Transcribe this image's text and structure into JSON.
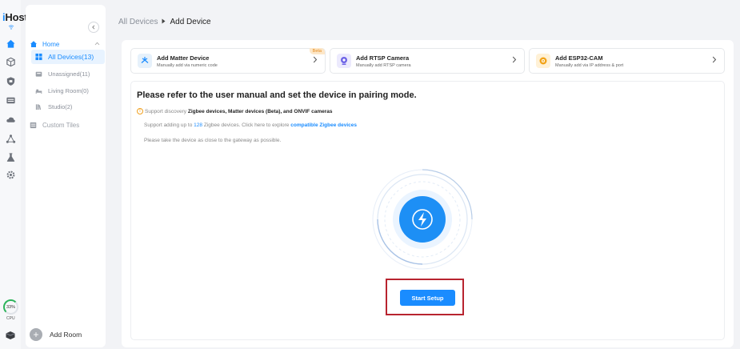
{
  "app": {
    "brand": "iHost",
    "brand_first": "i",
    "brand_rest": "Host"
  },
  "rail": {
    "icons": [
      "home-icon",
      "cube-icon",
      "shield-icon",
      "panel-icon",
      "cloud-icon",
      "network-icon",
      "flask-icon",
      "gear-icon"
    ],
    "cpu_value": "33%",
    "cpu_label": "CPU"
  },
  "sidebar": {
    "home_label": "Home",
    "items": [
      {
        "label": "All Devices(13)",
        "icon": "grid-icon",
        "active": true
      },
      {
        "label": "Unassigned(11)",
        "icon": "tray-icon",
        "active": false
      },
      {
        "label": "Living Room(0)",
        "icon": "bed-icon",
        "active": false
      },
      {
        "label": "Studio(2)",
        "icon": "books-icon",
        "active": false
      }
    ],
    "custom_tiles": "Custom Tiles",
    "add_room": "Add Room"
  },
  "breadcrumb": {
    "root": "All Devices",
    "current": "Add Device"
  },
  "cards": [
    {
      "title": "Add Matter Device",
      "subtitle": "Manually add via numeric code",
      "badge": "Beta",
      "icon": "matter-icon",
      "color": "#e6f1fb"
    },
    {
      "title": "Add RTSP Camera",
      "subtitle": "Manually add RTSP camera",
      "icon": "camera-icon",
      "color": "#eceafd"
    },
    {
      "title": "Add ESP32-CAM",
      "subtitle": "Manually add via IP address & port",
      "icon": "esp-cam-icon",
      "color": "#fff1d6"
    }
  ],
  "pairing": {
    "title": "Please refer to the user manual and set the device in pairing mode.",
    "support_prefix": "Support discovery",
    "support_devices": "Zigbee devices, Matter devices (Beta), and ONVIF cameras",
    "zigbee_prefix": "Support adding up to",
    "zigbee_count": "128",
    "zigbee_suffix": "Zigbee devices.   Click here to explore",
    "zigbee_link": "compatible Zigbee devices",
    "hint": "Please take the device as close to the gateway as possible.",
    "start_button": "Start Setup"
  },
  "colors": {
    "accent": "#1a8cff",
    "highlight": "#b8242f",
    "cpu": "#2db35a"
  }
}
